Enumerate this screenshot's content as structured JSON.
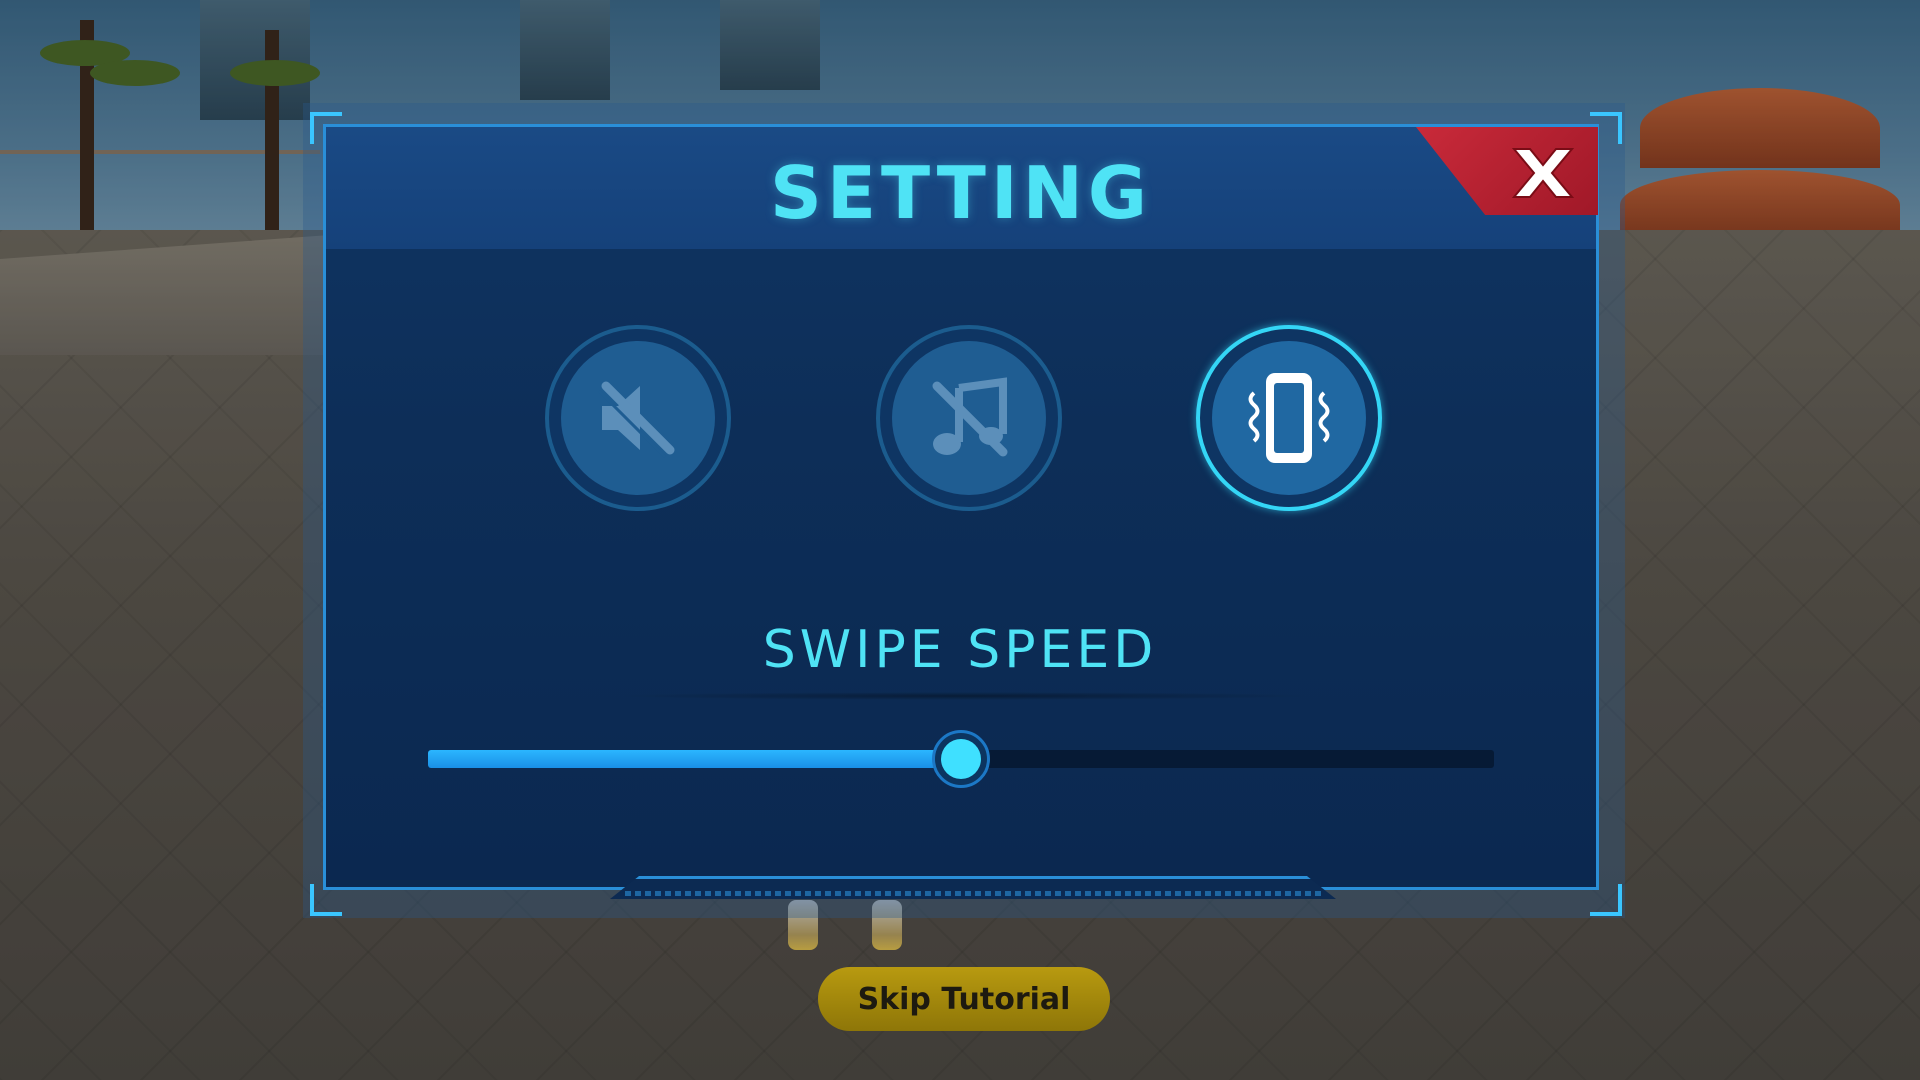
{
  "dialog": {
    "title": "SETTING",
    "close_icon": "close-x-icon",
    "toggles": [
      {
        "id": "sound",
        "icon": "sound-muted-icon",
        "state": "off"
      },
      {
        "id": "music",
        "icon": "music-off-icon",
        "state": "off"
      },
      {
        "id": "vibration",
        "icon": "vibration-icon",
        "state": "on"
      }
    ],
    "swipe_speed": {
      "label": "SWIPE SPEED",
      "value": 0.5
    }
  },
  "skip_tutorial": {
    "label": "Skip Tutorial"
  },
  "colors": {
    "accent_cyan": "#4fe3f5",
    "panel_bg": "#0d2e58",
    "close_red": "#c92a3a",
    "slider_fill": "#2bb6ff",
    "skip_yellow": "#b89a10"
  }
}
